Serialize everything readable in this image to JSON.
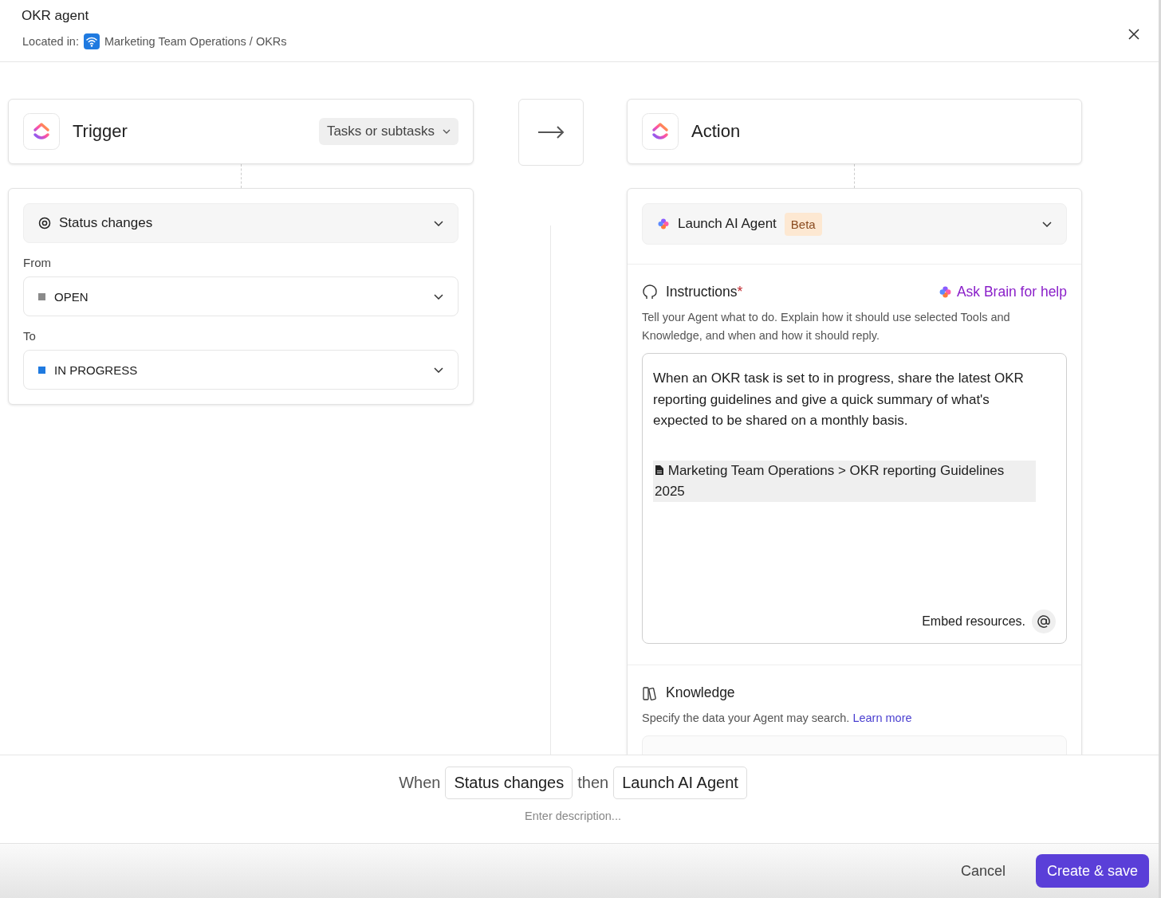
{
  "header": {
    "title": "OKR agent",
    "location_label": "Located in:",
    "location_path": "Marketing Team Operations / OKRs"
  },
  "trigger": {
    "title": "Trigger",
    "scope": "Tasks or subtasks",
    "event": "Status changes",
    "fields": [
      {
        "label": "From",
        "value": "OPEN",
        "color": "#8a8a8a"
      },
      {
        "label": "To",
        "value": "IN PROGRESS",
        "color": "#1f7ae0"
      }
    ]
  },
  "action": {
    "title": "Action",
    "type": "Launch AI Agent",
    "badge": "Beta",
    "instructions": {
      "label": "Instructions",
      "required_mark": "*",
      "help_link": "Ask Brain for help",
      "hint": "Tell your Agent what to do. Explain how it should use selected Tools and Knowledge, and when and how it should reply.",
      "value": "When an OKR task is set to in progress, share the latest OKR reporting guidelines and give a quick summary of what's expected to be shared on a monthly basis.",
      "attachment": "Marketing Team Operations > OKR reporting Guidelines 2025",
      "embed_label": "Embed resources."
    },
    "knowledge": {
      "label": "Knowledge",
      "hint": "Specify the data your Agent may search.",
      "link": "Learn more"
    }
  },
  "summary": {
    "when": "When",
    "trigger": "Status changes",
    "then": "then",
    "action": "Launch AI Agent",
    "description_placeholder": "Enter description..."
  },
  "footer": {
    "buttons": [
      {
        "label": "Cancel",
        "kind": "secondary"
      },
      {
        "label": "Create & save",
        "kind": "primary"
      }
    ]
  }
}
